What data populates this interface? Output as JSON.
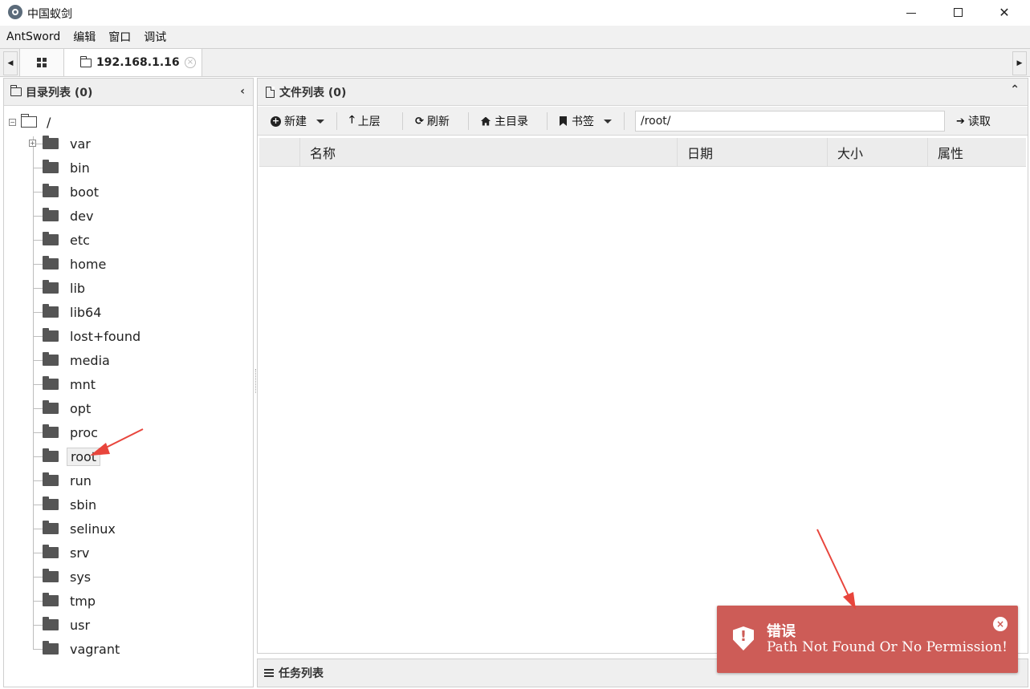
{
  "window": {
    "title": "中国蚁剑",
    "minimize_label": "—",
    "close_label": "✕"
  },
  "menu": {
    "items": [
      "AntSword",
      "编辑",
      "窗口",
      "调试"
    ]
  },
  "tabs": {
    "active_label": "192.168.1.16",
    "close_glyph": "×"
  },
  "left_panel": {
    "title": "目录列表 (0)",
    "collapse_glyph": "‹",
    "root_label": "/",
    "root_expander": "−",
    "folders": [
      "var",
      "bin",
      "boot",
      "dev",
      "etc",
      "home",
      "lib",
      "lib64",
      "lost+found",
      "media",
      "mnt",
      "opt",
      "proc",
      "root",
      "run",
      "sbin",
      "selinux",
      "srv",
      "sys",
      "tmp",
      "usr",
      "vagrant"
    ],
    "var_expander": "+",
    "selected": "root"
  },
  "right_panel": {
    "title": "文件列表 (0)",
    "collapse_glyph": "⌃",
    "toolbar": {
      "new_label": "新建",
      "up_label": "上层",
      "refresh_label": "刷新",
      "home_label": "主目录",
      "bookmark_label": "书签",
      "path_value": "/root/",
      "read_label": "读取"
    },
    "columns": {
      "name": "名称",
      "date": "日期",
      "size": "大小",
      "attr": "属性"
    }
  },
  "task_panel": {
    "title": "任务列表"
  },
  "toast": {
    "title": "错误",
    "message": "Path Not Found Or No Permission!",
    "close_glyph": "×",
    "background": "#cd5c57"
  },
  "icons": {
    "up": "🡑",
    "refresh": "⟳",
    "read": "➔"
  }
}
